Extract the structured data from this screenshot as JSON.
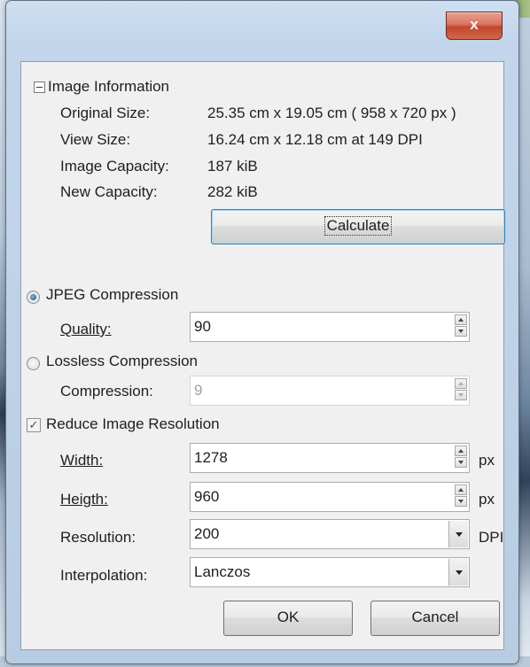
{
  "window": {
    "close_glyph": "x",
    "close_icon": "close-icon"
  },
  "image_info": {
    "section_title": "Image Information",
    "expander_icon": "collapse-minus-icon",
    "rows": [
      {
        "label": "Original Size:",
        "value": "25.35 cm x 19.05 cm ( 958 x 720 px )"
      },
      {
        "label": "View Size:",
        "value": "16.24 cm x 12.18 cm at 149 DPI"
      },
      {
        "label": "Image Capacity:",
        "value": "187 kiB"
      },
      {
        "label": "New Capacity:",
        "value": "282 kiB"
      }
    ],
    "calculate_label": "Calculate"
  },
  "jpeg": {
    "label": "JPEG Compression",
    "selected": true,
    "quality_label": "Quality:",
    "quality_value": "90"
  },
  "lossless": {
    "label": "Lossless Compression",
    "selected": false,
    "compression_label": "Compression:",
    "compression_value": "9"
  },
  "reduce": {
    "label": "Reduce Image Resolution",
    "checked": true,
    "check_glyph": "✓",
    "width_label": "Width:",
    "width_value": "1278",
    "width_unit": "px",
    "height_label": "Heigth:",
    "height_value": "960",
    "height_unit": "px",
    "resolution_label": "Resolution:",
    "resolution_value": "200",
    "resolution_unit": "DPI",
    "interpolation_label": "Interpolation:",
    "interpolation_value": "Lanczos"
  },
  "buttons": {
    "ok_label": "OK",
    "cancel_label": "Cancel"
  },
  "colors": {
    "frame": "#bfd2e7",
    "close": "#c2462f",
    "accent": "#3c7fb1"
  }
}
